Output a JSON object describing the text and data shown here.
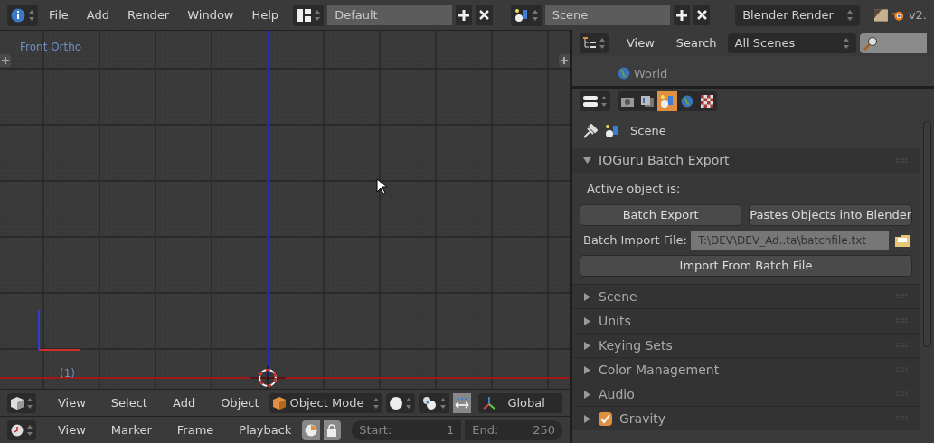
{
  "top_bar": {
    "menus": [
      "File",
      "Add",
      "Render",
      "Window",
      "Help"
    ],
    "layout": "Default",
    "scene": "Scene",
    "renderer": "Blender Render",
    "version": "v2."
  },
  "viewport": {
    "label": "Front Ortho",
    "frame": "(1)"
  },
  "viewport_header": {
    "menus": [
      "View",
      "Select",
      "Add",
      "Object"
    ],
    "mode": "Object Mode",
    "orientation": "Global"
  },
  "timeline_header": {
    "menus": [
      "View",
      "Marker",
      "Frame",
      "Playback"
    ],
    "start_label": "Start:",
    "start": "1",
    "end_label": "End:",
    "end": "250"
  },
  "outliner": {
    "menus": [
      "View",
      "Search"
    ],
    "filter": "All Scenes",
    "items": [
      {
        "label": "World"
      }
    ]
  },
  "properties": {
    "tabs": [
      {
        "kind": "render",
        "selected": false
      },
      {
        "kind": "layers",
        "selected": false
      },
      {
        "kind": "scene",
        "selected": true
      },
      {
        "kind": "world",
        "selected": false
      },
      {
        "kind": "texture",
        "selected": false
      }
    ],
    "context": "Scene",
    "panel": {
      "title": "IOGuru Batch Export",
      "expanded": true,
      "label": "Active object is:",
      "buttons": [
        "Batch Export",
        "Pastes Objects into Blender"
      ],
      "file_label": "Batch Import File:",
      "file_value": "T:\\DEV\\DEV_Ad..ta\\batchfile.txt",
      "import_button": "Import From Batch File"
    },
    "collapsed_panels": [
      {
        "title": "Scene",
        "kind": "plain",
        "expanded": false
      },
      {
        "title": "Units",
        "kind": "plain",
        "expanded": false
      },
      {
        "title": "Keying Sets",
        "kind": "plain",
        "expanded": false
      },
      {
        "title": "Color Management",
        "kind": "plain",
        "expanded": false
      },
      {
        "title": "Audio",
        "kind": "plain",
        "expanded": false
      },
      {
        "title": "Gravity",
        "kind": "checkbox",
        "checked": true,
        "expanded": false
      }
    ]
  }
}
